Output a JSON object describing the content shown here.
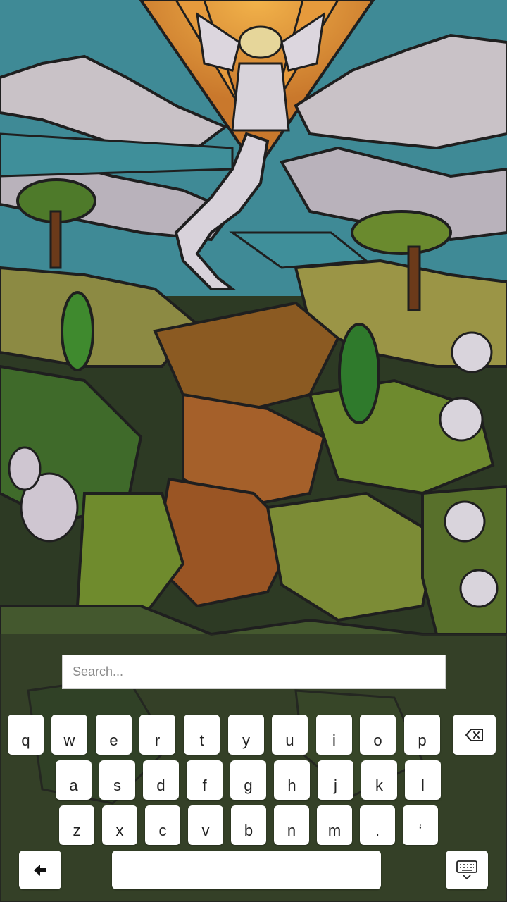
{
  "search": {
    "placeholder": "Search..."
  },
  "keyboard": {
    "row1": [
      "q",
      "w",
      "e",
      "r",
      "t",
      "y",
      "u",
      "i",
      "o",
      "p"
    ],
    "row2": [
      "a",
      "s",
      "d",
      "f",
      "g",
      "h",
      "j",
      "k",
      "l"
    ],
    "row3": [
      "z",
      "x",
      "c",
      "v",
      "b",
      "n",
      "m",
      ".",
      "‘"
    ],
    "icons": {
      "backspace": "backspace-icon",
      "back": "arrow-left-icon",
      "hide": "keyboard-hide-icon"
    }
  },
  "colors": {
    "key_bg": "#ffffff",
    "key_text": "#222222",
    "panel_overlay": "rgba(40,45,35,0.55)"
  }
}
